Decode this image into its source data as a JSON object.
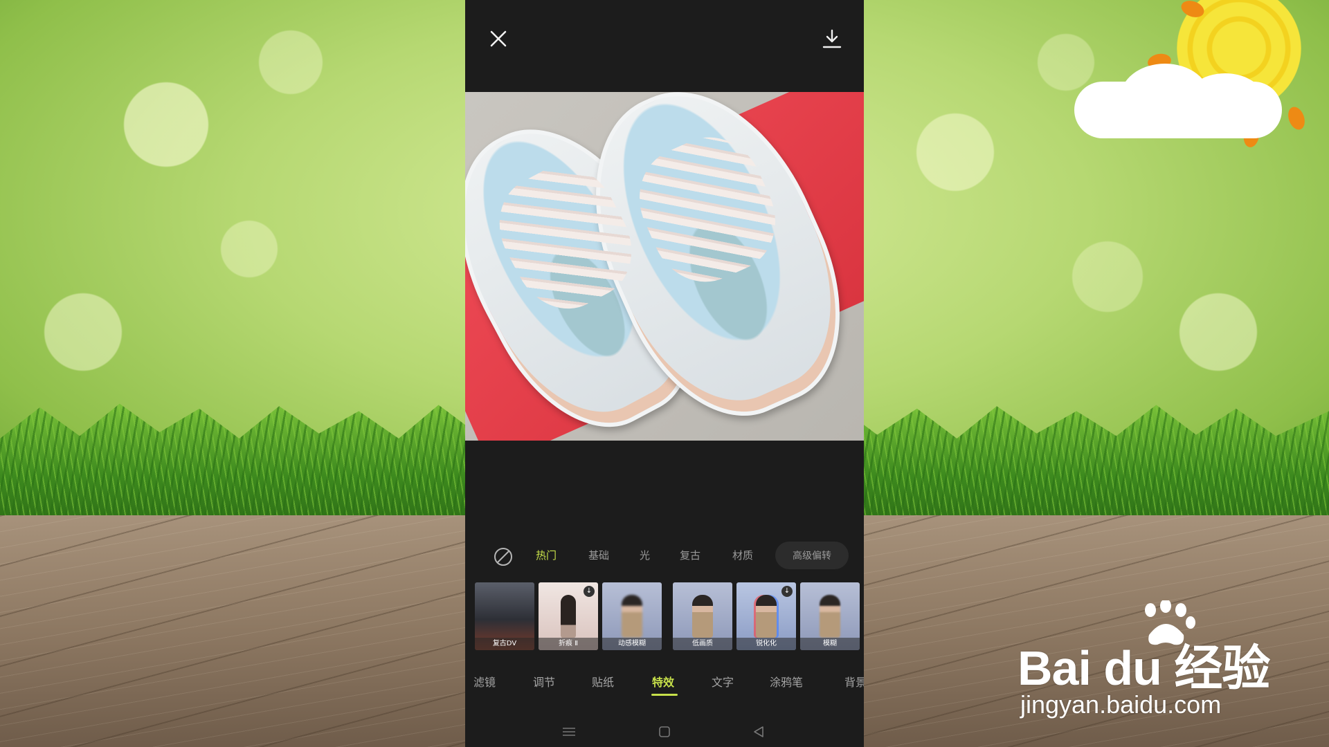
{
  "editor": {
    "categories": [
      {
        "label": "热门"
      },
      {
        "label": "基础"
      },
      {
        "label": "光"
      },
      {
        "label": "复古"
      },
      {
        "label": "材质"
      },
      {
        "label": "高级偏转"
      }
    ],
    "active_category": "热门",
    "effects": [
      {
        "label": "复古DV",
        "downloadable": false
      },
      {
        "label": "折痕 Ⅱ",
        "downloadable": true
      },
      {
        "label": "动感模糊",
        "downloadable": false
      },
      {
        "label": "低画质",
        "downloadable": false
      },
      {
        "label": "锐化化",
        "downloadable": true
      },
      {
        "label": "模糊",
        "downloadable": false
      }
    ],
    "tabs": [
      {
        "label": "滤镜"
      },
      {
        "label": "调节"
      },
      {
        "label": "贴纸"
      },
      {
        "label": "特效"
      },
      {
        "label": "文字"
      },
      {
        "label": "涂鸦笔"
      },
      {
        "label": "背景"
      }
    ],
    "active_tab": "特效",
    "icons": {
      "close": "close-icon",
      "download": "download-icon",
      "none": "no-effect-icon",
      "nav": [
        "menu-icon",
        "home-square-icon",
        "back-triangle-icon"
      ]
    },
    "accent_color": "#c7e04a"
  },
  "watermark": {
    "brand": "Bai du 经验",
    "url": "jingyan.baidu.com"
  }
}
